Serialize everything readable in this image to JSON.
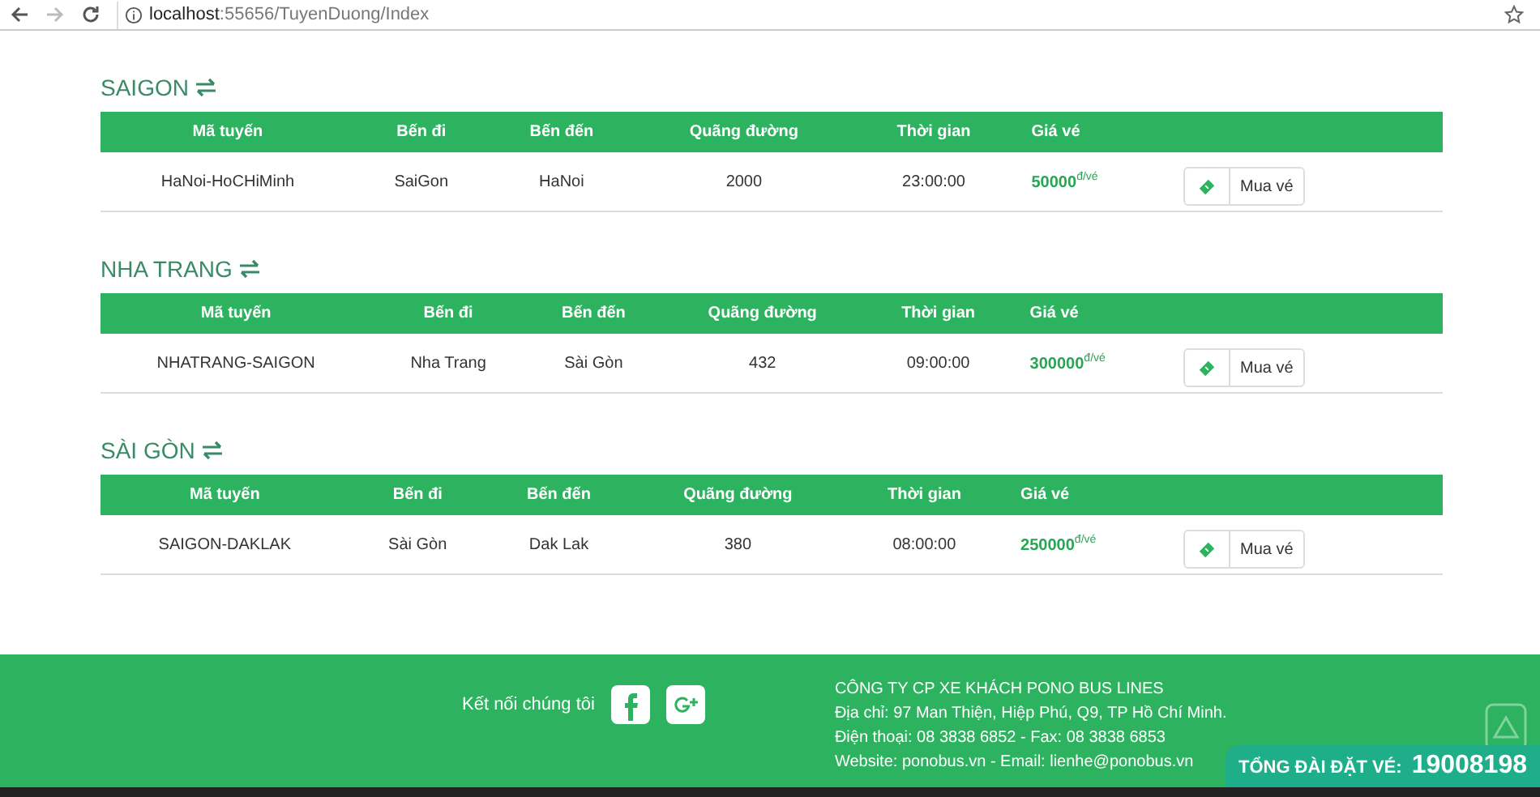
{
  "browser": {
    "url_host": "localhost",
    "url_path": ":55656/TuyenDuong/Index"
  },
  "sections": [
    {
      "title": "SAIGON",
      "columns": [
        "Mã tuyến",
        "Bến đi",
        "Bến đến",
        "Quãng đường",
        "Thời gian",
        "Giá vé"
      ],
      "rows": [
        {
          "route": "HaNoi-HoCHiMinh",
          "from": "SaiGon",
          "to": "HaNoi",
          "distance": "2000",
          "time": "23:00:00",
          "price": "50000",
          "unit": "đ/vé",
          "button": "Mua vé"
        }
      ]
    },
    {
      "title": "NHA TRANG",
      "columns": [
        "Mã tuyến",
        "Bến đi",
        "Bến đến",
        "Quãng đường",
        "Thời gian",
        "Giá vé"
      ],
      "rows": [
        {
          "route": "NHATRANG-SAIGON",
          "from": "Nha Trang",
          "to": "Sài Gòn",
          "distance": "432",
          "time": "09:00:00",
          "price": "300000",
          "unit": "đ/vé",
          "button": "Mua vé"
        }
      ]
    },
    {
      "title": "SÀI GÒN",
      "columns": [
        "Mã tuyến",
        "Bến đi",
        "Bến đến",
        "Quãng đường",
        "Thời gian",
        "Giá vé"
      ],
      "rows": [
        {
          "route": "SAIGON-DAKLAK",
          "from": "Sài Gòn",
          "to": "Dak Lak",
          "distance": "380",
          "time": "08:00:00",
          "price": "250000",
          "unit": "đ/vé",
          "button": "Mua vé"
        }
      ]
    }
  ],
  "footer": {
    "connect": "Kết nối chúng tôi",
    "company": "CÔNG TY CP XE KHÁCH PONO BUS LINES",
    "lines": [
      "Địa chỉ: 97 Man Thiện, Hiệp Phú, Q9, TP Hồ Chí Minh.",
      "Điện thoại: 08 3838 6852 - Fax: 08 3838 6853",
      "Website: ponobus.vn - Email: lienhe@ponobus.vn"
    ],
    "hotline_label": "TỔNG ĐÀI ĐẶT VÉ:",
    "hotline": "19008198"
  }
}
